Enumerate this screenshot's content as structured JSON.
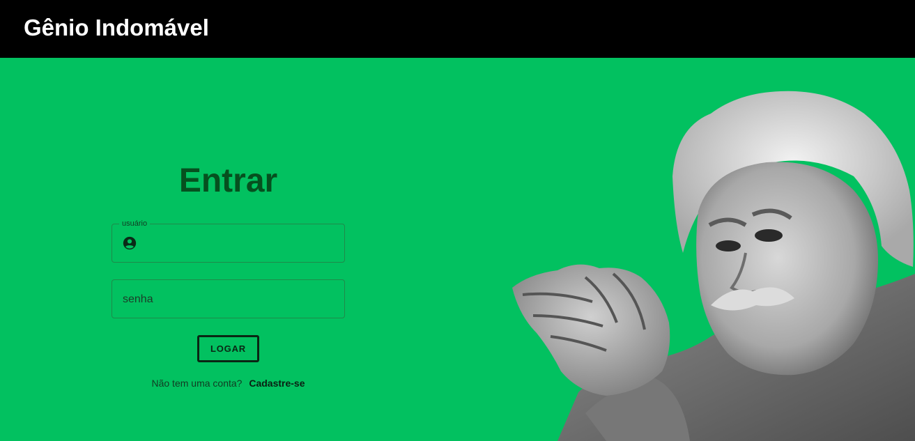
{
  "header": {
    "title": "Gênio Indomável",
    "background": "#000000"
  },
  "main": {
    "background": "#02c160"
  },
  "login": {
    "title": "Entrar",
    "username": {
      "label": "usuário",
      "value": "",
      "icon": "account-circle-icon"
    },
    "password": {
      "placeholder": "senha",
      "value": ""
    },
    "submit_label": "LOGAR",
    "signup_prompt": "Não tem uma conta?",
    "signup_link": "Cadastre-se"
  },
  "image": {
    "subject": "einstein-portrait"
  }
}
